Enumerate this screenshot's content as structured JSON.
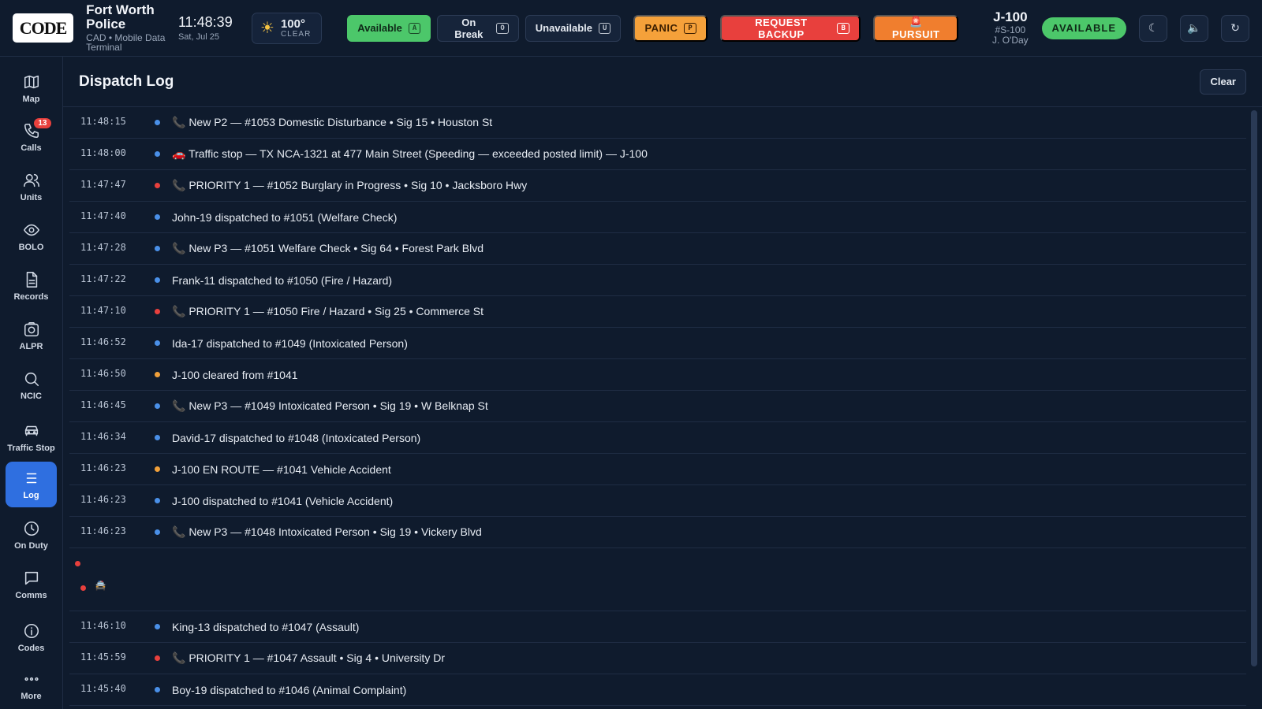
{
  "header": {
    "logo_text": "CODE",
    "agency_name": "Fort Worth Police",
    "agency_sub": "CAD • Mobile Data Terminal",
    "time": "11:48:39",
    "date": "Sat, Jul 25",
    "weather": {
      "icon": "sun-icon",
      "temp": "100°",
      "condition": "CLEAR"
    },
    "status_buttons": [
      {
        "label": "Available",
        "key": "A"
      },
      {
        "label": "On Break",
        "key": "O"
      },
      {
        "label": "Unavailable",
        "key": "U"
      }
    ],
    "panic": {
      "label": "PANIC",
      "key": "P"
    },
    "backup": {
      "label": "REQUEST BACKUP",
      "key": "B"
    },
    "pursuit": {
      "label": "🚨 PURSUIT"
    },
    "unit": {
      "id": "J-100",
      "sub": "#S-100",
      "officer": "J. O'Day",
      "status": "AVAILABLE"
    },
    "icons": {
      "theme": "☾",
      "audio": "🔈",
      "refresh": "↻"
    }
  },
  "sidebar": {
    "items": [
      {
        "label": "Map"
      },
      {
        "label": "Calls",
        "badge": "13"
      },
      {
        "label": "Units"
      },
      {
        "label": "BOLO"
      },
      {
        "label": "Records"
      },
      {
        "label": "ALPR"
      },
      {
        "label": "NCIC"
      },
      {
        "label": "Traffic Stop"
      },
      {
        "label": "Log"
      },
      {
        "label": "On Duty"
      },
      {
        "label": "Comms"
      },
      {
        "label": "Codes"
      },
      {
        "label": "More"
      }
    ]
  },
  "main": {
    "title": "Dispatch Log",
    "clear_label": "Clear",
    "entries": [
      {
        "time": "11:48:15",
        "dot": "blue",
        "msg": "📞 New P2 — #1053 Domestic Disturbance • Sig 15 • Houston St"
      },
      {
        "time": "11:48:00",
        "dot": "blue",
        "msg": "🚗 Traffic stop — TX NCA-1321 at 477 Main Street (Speeding — exceeded posted limit) — J-100"
      },
      {
        "time": "11:47:47",
        "dot": "red",
        "msg": "📞 PRIORITY 1 — #1052 Burglary in Progress • Sig 10 • Jacksboro Hwy"
      },
      {
        "time": "11:47:40",
        "dot": "blue",
        "msg": "John-19 dispatched to #1051 (Welfare Check)"
      },
      {
        "time": "11:47:28",
        "dot": "blue",
        "msg": "📞 New P3 — #1051 Welfare Check • Sig 64 • Forest Park Blvd"
      },
      {
        "time": "11:47:22",
        "dot": "blue",
        "msg": "Frank-11 dispatched to #1050 (Fire / Hazard)"
      },
      {
        "time": "11:47:10",
        "dot": "red",
        "msg": "📞 PRIORITY 1 — #1050 Fire / Hazard • Sig 25 • Commerce St"
      },
      {
        "time": "11:46:52",
        "dot": "blue",
        "msg": "Ida-17 dispatched to #1049 (Intoxicated Person)"
      },
      {
        "time": "11:46:50",
        "dot": "orange",
        "msg": "J-100 cleared from #1041"
      },
      {
        "time": "11:46:45",
        "dot": "blue",
        "msg": "📞 New P3 — #1049 Intoxicated Person • Sig 19 • W Belknap St"
      },
      {
        "time": "11:46:34",
        "dot": "blue",
        "msg": "David-17 dispatched to #1048 (Intoxicated Person)"
      },
      {
        "time": "11:46:23",
        "dot": "orange",
        "msg": "J-100 EN ROUTE — #1041 Vehicle Accident"
      },
      {
        "time": "11:46:23",
        "dot": "blue",
        "msg": "J-100 dispatched to #1041 (Vehicle Accident)"
      },
      {
        "time": "11:46:23",
        "dot": "blue",
        "msg": "📞 New P3 — #1048 Intoxicated Person • Sig 19 • Vickery Blvd"
      }
    ],
    "entries_after_gap": [
      {
        "time": "11:46:10",
        "dot": "blue",
        "msg": "King-13 dispatched to #1047 (Assault)"
      },
      {
        "time": "11:45:59",
        "dot": "red",
        "msg": "📞 PRIORITY 1 — #1047 Assault • Sig 4 • University Dr"
      },
      {
        "time": "11:45:40",
        "dot": "blue",
        "msg": "Boy-19 dispatched to #1046 (Animal Complaint)"
      }
    ]
  }
}
